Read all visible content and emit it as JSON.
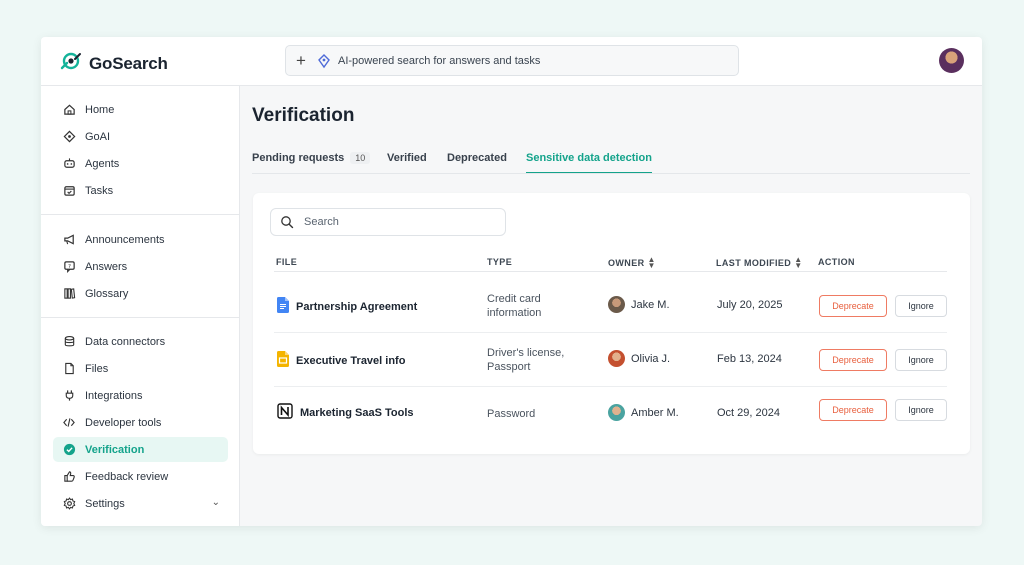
{
  "app": {
    "name": "GoSearch"
  },
  "colors": {
    "accent": "#14a38b",
    "deprecate": "#e8603f",
    "background": "#eef8f6"
  },
  "search": {
    "placeholder": "AI-powered search for answers and tasks"
  },
  "sidebar": {
    "groups": [
      [
        {
          "label": "Home",
          "icon": "home-icon"
        },
        {
          "label": "GoAI",
          "icon": "goai-icon"
        },
        {
          "label": "Agents",
          "icon": "robot-icon"
        },
        {
          "label": "Tasks",
          "icon": "calendar-check-icon"
        }
      ],
      [
        {
          "label": "Announcements",
          "icon": "megaphone-icon"
        },
        {
          "label": "Answers",
          "icon": "question-bubble-icon"
        },
        {
          "label": "Glossary",
          "icon": "books-icon"
        }
      ],
      [
        {
          "label": "Data connectors",
          "icon": "database-icon"
        },
        {
          "label": "Files",
          "icon": "file-icon"
        },
        {
          "label": "Integrations",
          "icon": "plug-icon"
        },
        {
          "label": "Developer tools",
          "icon": "code-icon"
        },
        {
          "label": "Verification",
          "icon": "check-badge-icon",
          "active": true
        },
        {
          "label": "Feedback review",
          "icon": "feedback-icon"
        },
        {
          "label": "Settings",
          "icon": "gear-icon"
        }
      ]
    ]
  },
  "page": {
    "title": "Verification",
    "tabs": [
      {
        "label": "Pending requests",
        "count": "10"
      },
      {
        "label": "Verified"
      },
      {
        "label": "Deprecated"
      },
      {
        "label": "Sensitive data detection",
        "active": true
      }
    ],
    "table_search_placeholder": "Search",
    "columns": {
      "file": "FILE",
      "type": "TYPE",
      "owner": "OWNER",
      "modified": "LAST MODIFIED",
      "action": "ACTION"
    },
    "actions": {
      "deprecate": "Deprecate",
      "ignore": "Ignore"
    },
    "rows": [
      {
        "file": "Partnership Agreement",
        "file_icon": "google-docs-icon",
        "type": "Credit card information",
        "owner": "Jake M.",
        "modified": "July 20, 2025"
      },
      {
        "file": "Executive Travel info",
        "file_icon": "google-slides-icon",
        "type": "Driver's license, Passport",
        "owner": "Olivia J.",
        "modified": "Feb 13, 2024"
      },
      {
        "file": "Marketing SaaS Tools",
        "file_icon": "notion-icon",
        "type": "Password",
        "owner": "Amber M.",
        "modified": "Oct 29, 2024"
      }
    ]
  }
}
